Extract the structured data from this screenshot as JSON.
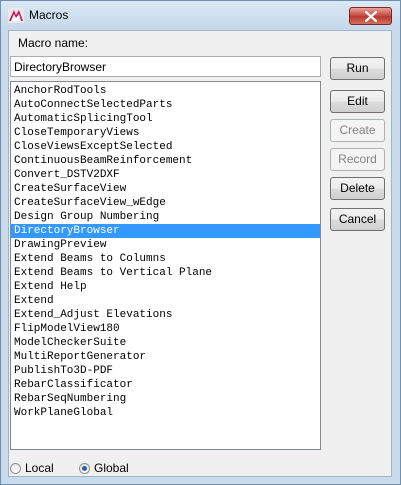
{
  "window": {
    "title": "Macros",
    "close_label": "Close"
  },
  "form": {
    "name_label": "Macro name:",
    "name_value": "DirectoryBrowser"
  },
  "macros": [
    "AnchorRodTools",
    "AutoConnectSelectedParts",
    "AutomaticSplicingTool",
    "CloseTemporaryViews",
    "CloseViewsExceptSelected",
    "ContinuousBeamReinforcement",
    "Convert_DSTV2DXF",
    "CreateSurfaceView",
    "CreateSurfaceView_wEdge",
    "Design Group Numbering",
    "DirectoryBrowser",
    "DrawingPreview",
    "Extend Beams to Columns",
    "Extend Beams to Vertical Plane",
    "Extend Help",
    "Extend",
    "Extend_Adjust Elevations",
    "FlipModelView180",
    "ModelCheckerSuite",
    "MultiReportGenerator",
    "PublishTo3D-PDF",
    "RebarClassificator",
    "RebarSeqNumbering",
    "WorkPlaneGlobal"
  ],
  "selected_macro": "DirectoryBrowser",
  "buttons": {
    "run": "Run",
    "edit": "Edit",
    "create": "Create",
    "record": "Record",
    "delete": "Delete",
    "cancel": "Cancel"
  },
  "scope": {
    "local_label": "Local",
    "global_label": "Global",
    "selected": "Global"
  },
  "colors": {
    "selection": "#3399ff",
    "title_bar": "#c9daea",
    "close_button": "#c4463a"
  }
}
